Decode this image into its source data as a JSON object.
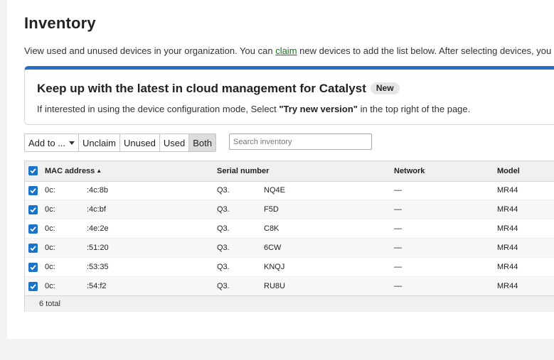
{
  "page": {
    "title": "Inventory",
    "intro_before": "View used and unused devices in your organization. You can ",
    "intro_link": "claim",
    "intro_after": " new devices to add the list below. After selecting devices, you can add them to a network."
  },
  "banner": {
    "heading": "Keep up with the latest in cloud management for Catalyst",
    "badge": "New",
    "body_before": "If interested in using the device configuration mode, Select ",
    "body_bold": "\"Try new version\"",
    "body_after": " in the top right of the page.",
    "accent_color": "#2a6ec8"
  },
  "toolbar": {
    "add_to_label": "Add to ...",
    "unclaim_label": "Unclaim",
    "unused_label": "Unused",
    "used_label": "Used",
    "both_label": "Both",
    "active_filter": "Both"
  },
  "search": {
    "placeholder": "Search inventory",
    "value": ""
  },
  "table": {
    "columns": {
      "mac": "MAC address",
      "sort_indicator": "▲",
      "serial": "Serial number",
      "network": "Network",
      "model": "Model"
    },
    "rows": [
      {
        "mac_prefix": "0c:",
        "mac_suffix": ":4c:8b",
        "serial_prefix": "Q3.",
        "serial_suffix": "NQ4E",
        "network": "—",
        "model": "MR44",
        "checked": true
      },
      {
        "mac_prefix": "0c:",
        "mac_suffix": ":4c:bf",
        "serial_prefix": "Q3.",
        "serial_suffix": "F5D",
        "network": "—",
        "model": "MR44",
        "checked": true
      },
      {
        "mac_prefix": "0c:",
        "mac_suffix": ":4e:2e",
        "serial_prefix": "Q3.",
        "serial_suffix": "C8K",
        "network": "—",
        "model": "MR44",
        "checked": true
      },
      {
        "mac_prefix": "0c:",
        "mac_suffix": ":51:20",
        "serial_prefix": "Q3.",
        "serial_suffix": "6CW",
        "network": "—",
        "model": "MR44",
        "checked": true
      },
      {
        "mac_prefix": "0c:",
        "mac_suffix": ":53:35",
        "serial_prefix": "Q3.",
        "serial_suffix": "KNQJ",
        "network": "—",
        "model": "MR44",
        "checked": true
      },
      {
        "mac_prefix": "0c:",
        "mac_suffix": ":54:f2",
        "serial_prefix": "Q3.",
        "serial_suffix": "RU8U",
        "network": "—",
        "model": "MR44",
        "checked": true
      }
    ],
    "total_label": "6 total",
    "checkbox_color": "#1a73c8"
  }
}
